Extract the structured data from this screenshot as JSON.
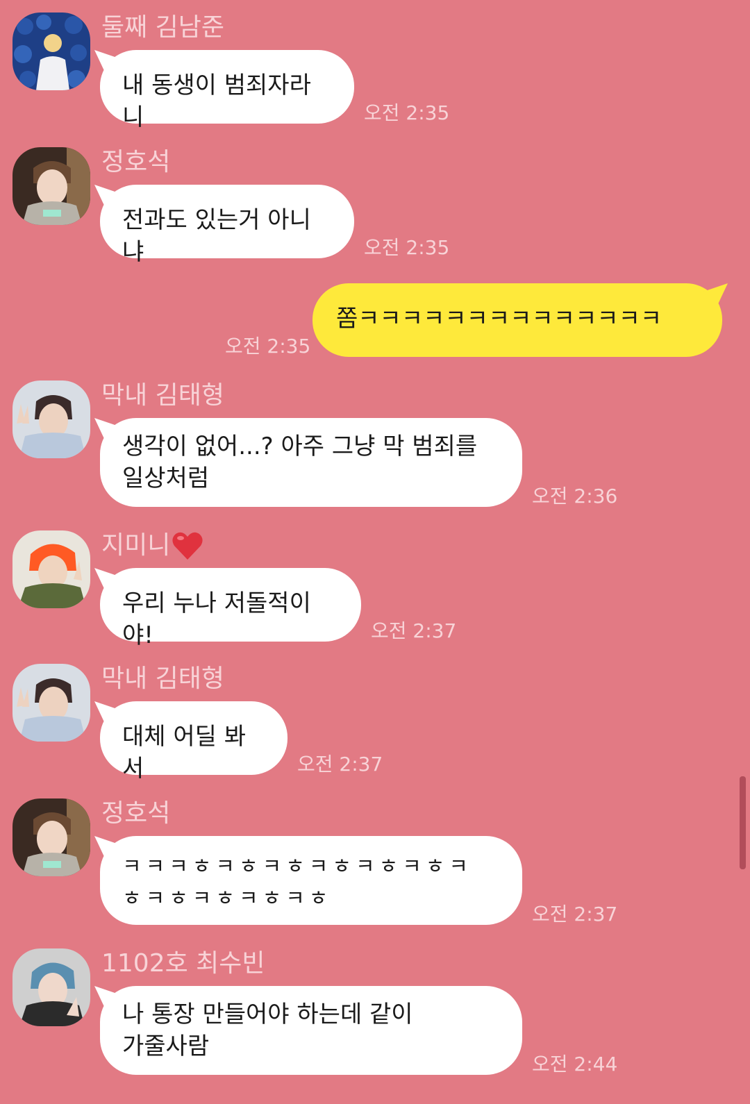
{
  "colors": {
    "background": "#e27a84",
    "incoming_bubble": "#ffffff",
    "outgoing_bubble": "#fee93b",
    "meta_text": "#f8d3d7"
  },
  "messages": [
    {
      "sender": "둘째 김남준",
      "text": "내 동생이 범죄자라니",
      "time": "오전 2:35",
      "avatar": "avatar-blue-roses"
    },
    {
      "sender": "정호석",
      "text": "전과도 있는거 아니냐",
      "time": "오전 2:35",
      "avatar": "avatar-brown-hair"
    },
    {
      "sender": "",
      "text": "쫌ㅋㅋㅋㅋㅋㅋㅋㅋㅋㅋㅋㅋㅋㅋ",
      "time": "오전 2:35",
      "avatar": ""
    },
    {
      "sender": "막내 김태형",
      "text": "생각이 없어...? 아주 그냥 막 범죄를\n일상처럼",
      "time": "오전 2:36",
      "avatar": "avatar-peace-sign"
    },
    {
      "sender": "지미니",
      "text": "우리 누나 저돌적이야!",
      "time": "오전 2:37",
      "avatar": "avatar-orange-hair",
      "sender_icon": "heart-icon"
    },
    {
      "sender": "막내 김태형",
      "text": "대체 어딜 봐서",
      "time": "오전 2:37",
      "avatar": "avatar-peace-sign"
    },
    {
      "sender": "정호석",
      "text": "ㅋㅋㅋㅎㅋㅎㅋㅎㅋㅎㅋㅎㅋㅎㅋ\nㅎㅋㅎㅋㅎㅋㅎㅋㅎ",
      "time": "오전 2:37",
      "avatar": "avatar-brown-hair"
    },
    {
      "sender": "1102호 최수빈",
      "text": "나 통장 만들어야 하는데 같이\n가줄사람",
      "time": "오전 2:44",
      "avatar": "avatar-blue-hair"
    }
  ]
}
